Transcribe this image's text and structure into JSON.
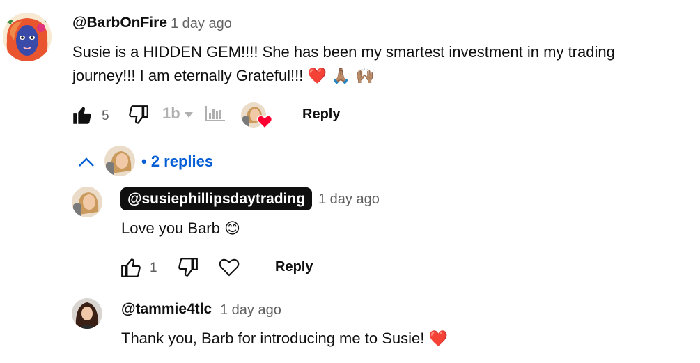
{
  "comment": {
    "author": "@BarbOnFire",
    "time": "1 day ago",
    "text_line1": "Susie is a HIDDEN GEM!!!! She has been my smartest investment in my trading",
    "text_line2": "journey!!! I am eternally Grateful!!!",
    "emojis": "❤️ 🙏🏽 🙌🏽",
    "like_count": "5",
    "reply_label": "Reply",
    "replies_label": "• 2 replies"
  },
  "replies": [
    {
      "author": "@susiephillipsdaytrading",
      "time": "1 day ago",
      "text": "Love you Barb",
      "emoji": "😊",
      "like_count": "1",
      "reply_label": "Reply"
    },
    {
      "author": "@tammie4tlc",
      "time": "1 day ago",
      "text": "Thank you, Barb for introducing me to Susie!",
      "emoji": "❤️"
    }
  ],
  "icons": {
    "like": "thumb-up-icon",
    "dislike": "thumb-down-icon",
    "tipranks": "tb-extension-icon",
    "chart": "bar-chart-icon",
    "heart": "heart-icon",
    "collapse": "chevron-up-icon"
  },
  "colors": {
    "link": "#065fd4",
    "heart": "#ff0033",
    "muted": "#606060"
  }
}
